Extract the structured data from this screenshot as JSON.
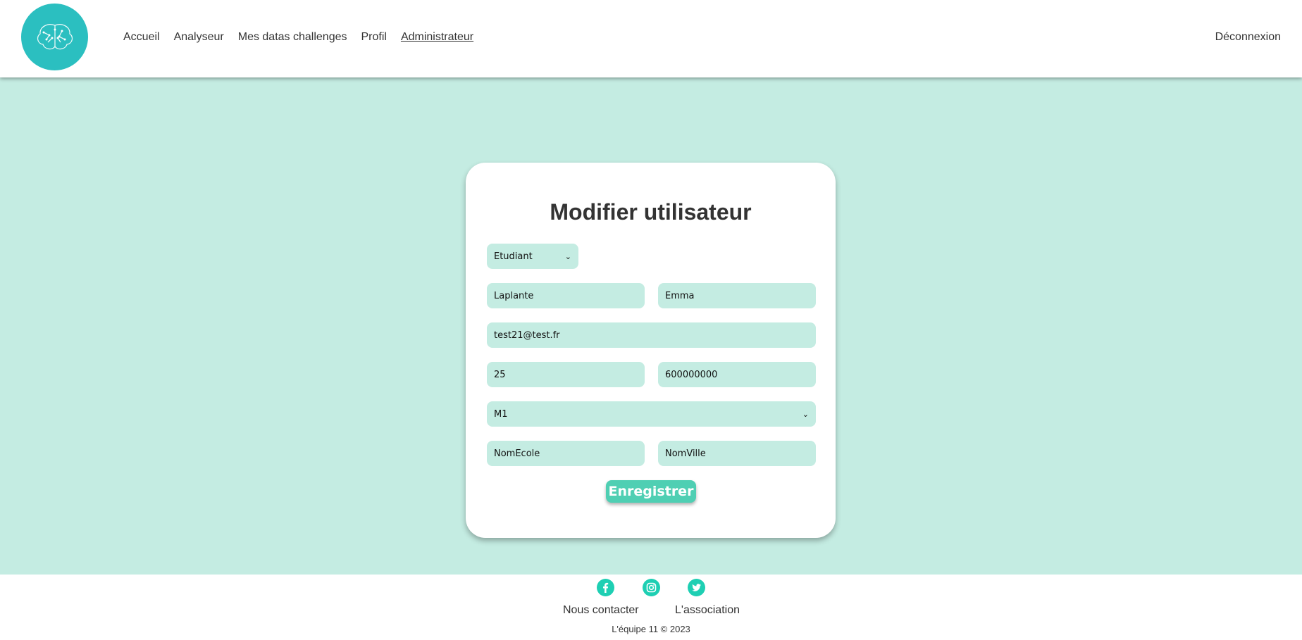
{
  "nav": {
    "items": [
      "Accueil",
      "Analyseur",
      "Mes datas challenges",
      "Profil",
      "Administrateur"
    ],
    "active": "Administrateur",
    "logout": "Déconnexion"
  },
  "form": {
    "title": "Modifier utilisateur",
    "role": "Etudiant",
    "last_name": "Laplante",
    "first_name": "Emma",
    "email": "test21@test.fr",
    "age": "25",
    "phone": "600000000",
    "level": "M1",
    "school": "NomEcole",
    "city": "NomVille",
    "submit_label": "Enregistrer"
  },
  "footer": {
    "social_icons": [
      "facebook-icon",
      "instagram-icon",
      "twitter-icon"
    ],
    "contact_label": "Nous contacter",
    "association_label": "L'association",
    "copyright": "L'équipe 11 © 2023"
  },
  "colors": {
    "accent": "#2bbfc0",
    "background": "#c4ece2",
    "button": "#4fcfb3",
    "social": "#1ecfb3"
  }
}
